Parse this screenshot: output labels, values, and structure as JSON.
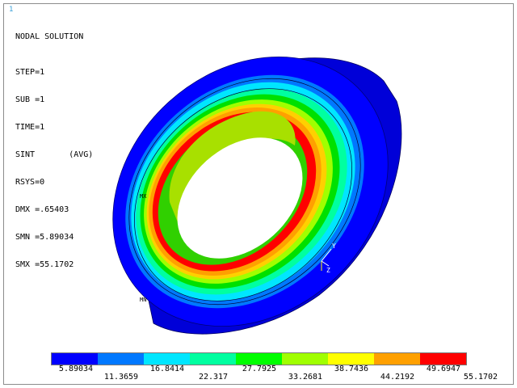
{
  "window_id": "1",
  "solution": {
    "title": "NODAL SOLUTION",
    "lines": [
      "STEP=1",
      "SUB =1",
      "TIME=1",
      "SINT       (AVG)",
      "RSYS=0",
      "DMX =.65403",
      "SMN =5.89034",
      "SMX =55.1702"
    ]
  },
  "model_labels": {
    "mx": "MX",
    "mn": "MN"
  },
  "triad": {
    "y": "Y",
    "z": "Z"
  },
  "colors": {
    "bands": [
      "#0000ff",
      "#0078ff",
      "#00e6ff",
      "#00ffa0",
      "#00ff00",
      "#a0ff00",
      "#ffff00",
      "#ffa000",
      "#ff0000"
    ],
    "frame": "#8c8c8c"
  },
  "legend": {
    "values_top": [
      "5.89034",
      "16.8414",
      "27.7925",
      "38.7436",
      "49.6947"
    ],
    "values_bottom": [
      "11.3659",
      "22.317",
      "33.2681",
      "44.2192",
      "55.1702"
    ]
  }
}
